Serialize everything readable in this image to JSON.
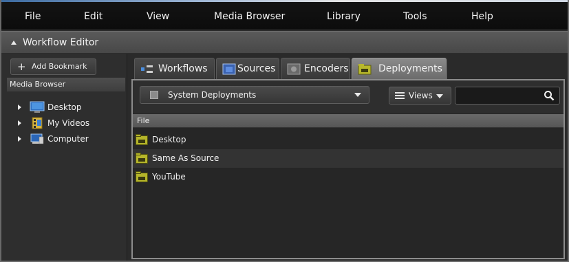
{
  "menubar": {
    "items": [
      "File",
      "Edit",
      "View",
      "Media Browser",
      "Library",
      "Tools",
      "Help"
    ]
  },
  "workflow_editor": {
    "title": "Workflow Editor"
  },
  "sidebar": {
    "add_bookmark_label": "Add Bookmark",
    "section_title": "Media Browser",
    "tree": [
      {
        "label": "Desktop",
        "icon": "desktop-icon"
      },
      {
        "label": "My Videos",
        "icon": "videos-folder-icon"
      },
      {
        "label": "Computer",
        "icon": "computer-icon"
      }
    ]
  },
  "tabs": [
    {
      "label": "Workflows",
      "icon": "workflows-icon",
      "active": false
    },
    {
      "label": "Sources",
      "icon": "sources-icon",
      "active": false
    },
    {
      "label": "Encoders",
      "icon": "encoders-icon",
      "active": false
    },
    {
      "label": "Deployments",
      "icon": "deployments-icon",
      "active": true
    }
  ],
  "toolbar": {
    "dropdown_value": "System Deployments",
    "views_label": "Views",
    "search_placeholder": ""
  },
  "file_list": {
    "column_header": "File",
    "rows": [
      {
        "label": "Desktop",
        "icon": "deployment-folder-icon"
      },
      {
        "label": "Same As Source",
        "icon": "deployment-folder-icon"
      },
      {
        "label": "YouTube",
        "icon": "deployment-folder-icon"
      }
    ]
  },
  "colors": {
    "menubar_bg": "#0c0c0c",
    "panel_bg": "#2a2a2a",
    "active_tab": "#7a7a7a",
    "folder_icon": "#b5b52a"
  }
}
